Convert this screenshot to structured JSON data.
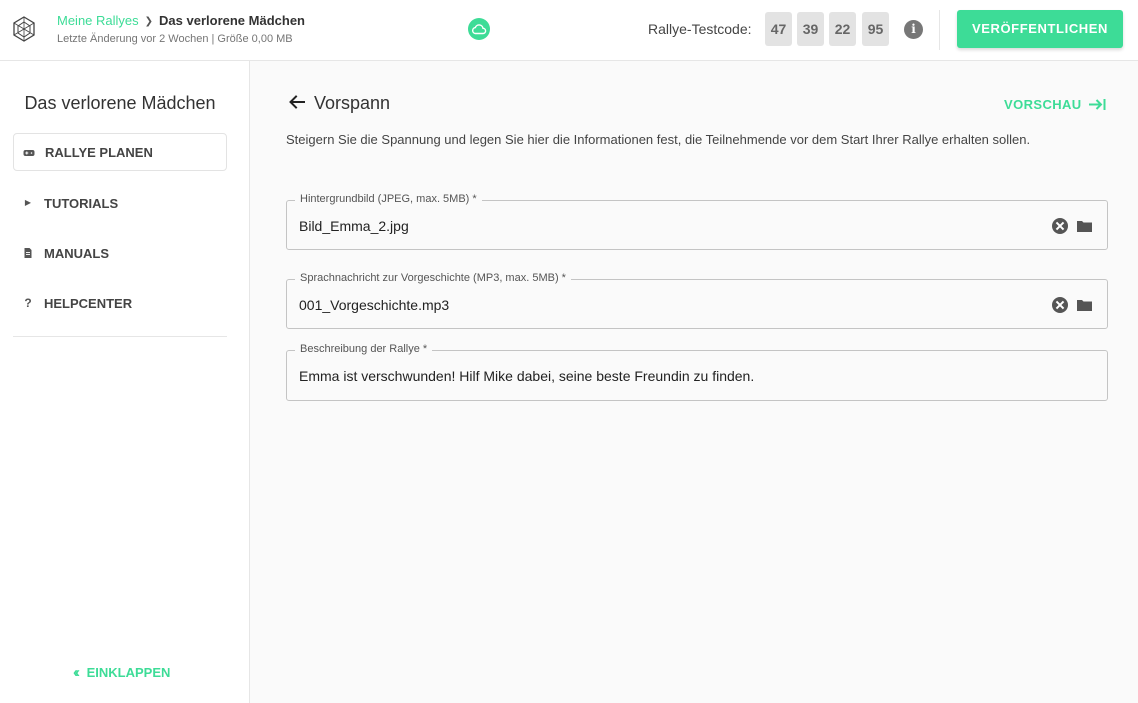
{
  "header": {
    "breadcrumb_root": "Meine Rallyes",
    "breadcrumb_current": "Das verlorene Mädchen",
    "subline": "Letzte Änderung vor 2 Wochen | Größe 0,00 MB",
    "testcode_label": "Rallye-Testcode:",
    "testcode": [
      "47",
      "39",
      "22",
      "95"
    ],
    "info_label": "i",
    "publish_label": "VERÖFFENTLICHEN"
  },
  "sidebar": {
    "title": "Das verlorene Mädchen",
    "items": [
      {
        "label": "RALLYE PLANEN",
        "icon": "gamepad-icon",
        "active": true
      },
      {
        "label": "TUTORIALS",
        "icon": "play-icon",
        "active": false
      },
      {
        "label": "MANUALS",
        "icon": "document-icon",
        "active": false
      },
      {
        "label": "HELPCENTER",
        "icon": "question-icon",
        "active": false
      }
    ],
    "collapse_label": "EINKLAPPEN"
  },
  "main": {
    "title": "Vorspann",
    "preview_label": "VORSCHAU",
    "intro": "Steigern Sie die Spannung und legen Sie hier die Informationen fest, die Teilnehmende vor dem Start Ihrer Rallye erhalten sollen.",
    "fields": [
      {
        "label": "Hintergrundbild (JPEG, max. 5MB) *",
        "value": "Bild_Emma_2.jpg"
      },
      {
        "label": "Sprachnachricht zur Vorgeschichte (MP3, max. 5MB) *",
        "value": "001_Vorgeschichte.mp3"
      },
      {
        "label": "Beschreibung der Rallye *",
        "value": "Emma ist verschwunden! Hilf Mike dabei, seine beste Freundin zu finden."
      }
    ]
  },
  "colors": {
    "accent": "#3ddc97",
    "text": "#333333",
    "border": "#c4c4c4"
  }
}
